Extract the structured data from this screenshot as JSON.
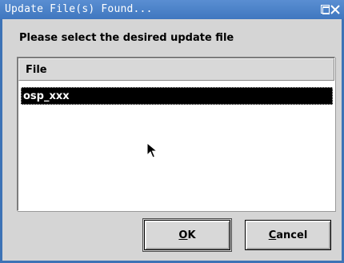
{
  "window": {
    "title": "Update File(s) Found...",
    "prompt": "Please select the desired update file"
  },
  "list": {
    "column_header": "File",
    "rows": [
      {
        "label": "osp_xxx",
        "selected": true
      }
    ]
  },
  "buttons": {
    "ok": {
      "mnemonic": "O",
      "rest": "K"
    },
    "cancel": {
      "mnemonic": "C",
      "rest": "ancel"
    }
  },
  "colors": {
    "titlebar": "#3f77bf",
    "dialog_bg": "#d5d5d5",
    "selection": "#000000"
  },
  "icons": [
    "maximize-icon",
    "close-icon",
    "mouse-pointer-icon"
  ]
}
